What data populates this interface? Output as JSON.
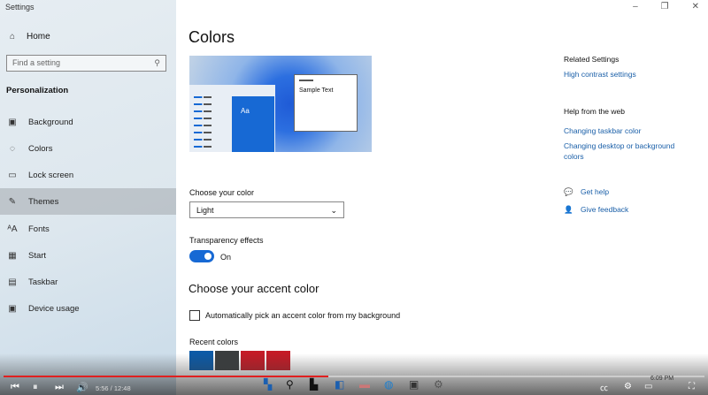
{
  "window": {
    "title": "Settings",
    "controls": [
      "minimize",
      "restore",
      "close"
    ]
  },
  "sidebar": {
    "home": "Home",
    "search_placeholder": "Find a setting",
    "section": "Personalization",
    "items": [
      {
        "label": "Background",
        "icon": "image-icon"
      },
      {
        "label": "Colors",
        "icon": "palette-icon"
      },
      {
        "label": "Lock screen",
        "icon": "lock-screen-icon"
      },
      {
        "label": "Themes",
        "icon": "brush-icon",
        "active": true
      },
      {
        "label": "Fonts",
        "icon": "font-icon"
      },
      {
        "label": "Start",
        "icon": "start-icon"
      },
      {
        "label": "Taskbar",
        "icon": "taskbar-icon"
      },
      {
        "label": "Device usage",
        "icon": "device-icon"
      }
    ]
  },
  "main": {
    "title": "Colors",
    "preview": {
      "sample_text": "Sample Text",
      "tile_text": "Aa"
    },
    "choose_color": {
      "label": "Choose your color",
      "value": "Light"
    },
    "transparency": {
      "label": "Transparency effects",
      "state": "On",
      "enabled": true
    },
    "accent_heading": "Choose your accent color",
    "auto_pick": {
      "label": "Automatically pick an accent color from my background",
      "checked": false
    },
    "recent_colors": {
      "label": "Recent colors",
      "colors": [
        "#0c5aa6",
        "#3a3d3e",
        "#c41b26",
        "#c41b26"
      ]
    }
  },
  "related": {
    "heading": "Related Settings",
    "high_contrast": "High contrast settings",
    "help_heading": "Help from the web",
    "help_links": [
      "Changing taskbar color",
      "Changing desktop or background colors"
    ],
    "get_help": "Get help",
    "give_feedback": "Give feedback"
  },
  "video": {
    "time": "5:56 / 12:48",
    "progress": 0.464,
    "clock": "6:09 PM"
  }
}
